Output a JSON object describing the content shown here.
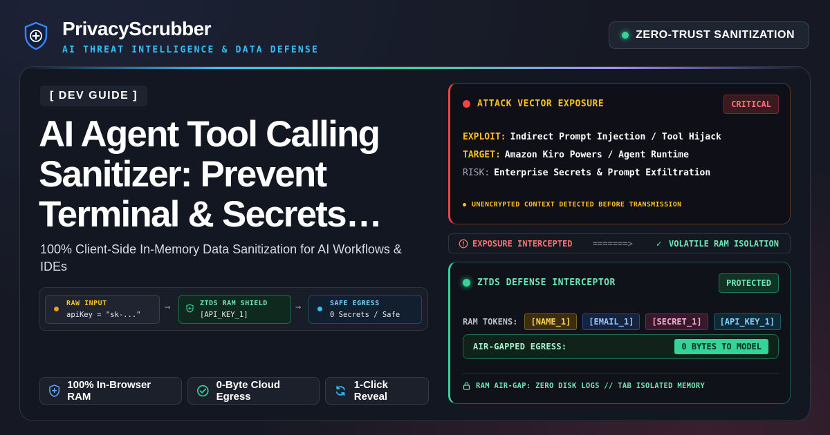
{
  "brand": {
    "name": "PrivacyScrubber",
    "tagline": "AI THREAT INTELLIGENCE & DATA DEFENSE",
    "logo_icon": "shield-plus-icon"
  },
  "top_pill": {
    "label": "ZERO-TRUST SANITIZATION",
    "icon": "status-dot"
  },
  "hero": {
    "tag": "[ DEV GUIDE ]",
    "headline": "AI Agent Tool Calling Sanitizer: Prevent Terminal & Secrets…",
    "subtitle": "100% Client-Side In-Memory Data Sanitization for AI Workflows & IDEs"
  },
  "pipeline": {
    "raw": {
      "title": "RAW INPUT",
      "value": "apiKey = \"sk-...\""
    },
    "shield": {
      "title": "ZTDS RAM SHIELD",
      "value": "[API_KEY_1]"
    },
    "egress": {
      "title": "SAFE EGRESS",
      "value": "0 Secrets / Safe"
    }
  },
  "features": [
    {
      "label": "100% In-Browser RAM",
      "icon": "shield-plus-icon"
    },
    {
      "label": "0-Byte Cloud Egress",
      "icon": "check-circle-icon"
    },
    {
      "label": "1-Click Reveal",
      "icon": "refresh-icon"
    }
  ],
  "attack": {
    "title": "ATTACK VECTOR EXPOSURE",
    "badge": "CRITICAL",
    "exploit_label": "EXPLOIT:",
    "exploit_value": "Indirect Prompt Injection / Tool Hijack",
    "target_label": "TARGET:",
    "target_value": "Amazon Kiro Powers / Agent Runtime",
    "risk_label": "RISK:",
    "risk_value": "Enterprise Secrets & Prompt Exfiltration",
    "footer": "UNENCRYPTED CONTEXT DETECTED BEFORE TRANSMISSION"
  },
  "status_strip": {
    "left": "EXPOSURE INTERCEPTED",
    "arrow": "=======>",
    "right": "VOLATILE RAM ISOLATION"
  },
  "defense": {
    "title": "ZTDS DEFENSE INTERCEPTOR",
    "badge": "PROTECTED",
    "tokens_label": "RAM TOKENS:",
    "tokens": [
      "[NAME_1]",
      "[EMAIL_1]",
      "[SECRET_1]",
      "[API_KEY_1]"
    ],
    "egress_label": "AIR-GAPPED EGRESS:",
    "egress_value": "0 BYTES TO MODEL",
    "footer": "RAM AIR-GAP: ZERO DISK LOGS // TAB ISOLATED MEMORY"
  },
  "colors": {
    "accent_blue": "#38bdf8",
    "accent_green": "#34d399",
    "critical_red": "#ef4444",
    "warning_amber": "#fbbf24"
  }
}
